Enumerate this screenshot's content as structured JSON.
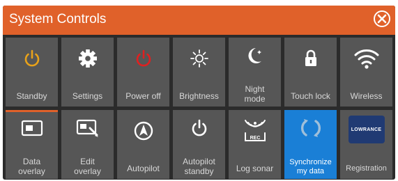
{
  "dialog": {
    "title": "System Controls",
    "close_icon": "close-circle-icon",
    "accent_color": "#e0612a",
    "active_color": "#1a7fd6"
  },
  "tiles_row1": [
    {
      "label": "Standby",
      "icon": "power-icon"
    },
    {
      "label": "Settings",
      "icon": "gear-icon"
    },
    {
      "label": "Power off",
      "icon": "power-icon"
    },
    {
      "label": "Brightness",
      "icon": "sun-icon"
    },
    {
      "label": "Night\nmode",
      "icon": "moon-icon"
    },
    {
      "label": "Touch lock",
      "icon": "lock-icon"
    },
    {
      "label": "Wireless",
      "icon": "wifi-icon"
    }
  ],
  "tiles_row2": [
    {
      "label": "Data\noverlay",
      "icon": "data-overlay-icon",
      "selected": true
    },
    {
      "label": "Edit\noverlay",
      "icon": "edit-overlay-icon"
    },
    {
      "label": "Autopilot",
      "icon": "autopilot-icon"
    },
    {
      "label": "Autopilot\nstandby",
      "icon": "power-icon"
    },
    {
      "label": "Log sonar",
      "icon": "log-sonar-icon",
      "icon_text": "REC"
    },
    {
      "label": "Synchronize\nmy data",
      "icon": "sync-icon",
      "active": true
    },
    {
      "label": "Registration",
      "icon": "lowrance-logo-icon",
      "logo_text": "LOWRANCE"
    }
  ]
}
